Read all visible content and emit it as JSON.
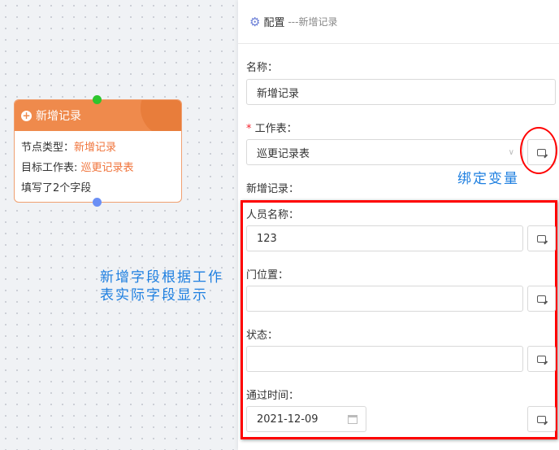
{
  "node": {
    "title": "新增记录",
    "rows": [
      {
        "label": "节点类型：",
        "value": "新增记录"
      },
      {
        "label": "目标工作表:",
        "value": "巡更记录表"
      },
      {
        "label": "填写了2个字段",
        "value": ""
      }
    ]
  },
  "panel": {
    "title": "配置",
    "subtitle": "---新增记录",
    "name_label": "名称：",
    "name_value": "新增记录",
    "sheet_required": "*",
    "sheet_label": "工作表：",
    "sheet_value": "巡更记录表",
    "record_label": "新增记录：",
    "fields": [
      {
        "label": "人员名称：",
        "value": "123"
      },
      {
        "label": "门位置：",
        "value": ""
      },
      {
        "label": "状态：",
        "value": ""
      },
      {
        "label": "通过时间：",
        "value": "2021-12-09"
      }
    ]
  },
  "annotations": {
    "bind": "绑定变量",
    "fields_line1": "新增字段根据工作",
    "fields_line2": "表实际字段显示"
  },
  "colors": {
    "accent": "#ef8a4c",
    "annotation": "#1e7fe0",
    "highlight": "#ff0000"
  }
}
